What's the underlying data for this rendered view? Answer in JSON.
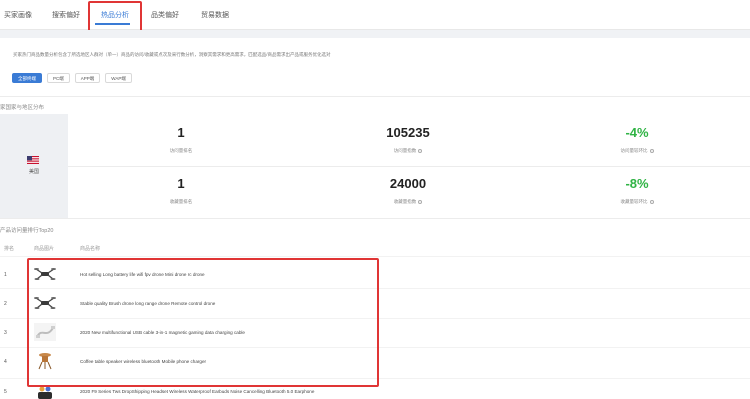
{
  "tabs": [
    {
      "label": "买家画像"
    },
    {
      "label": "搜索偏好"
    },
    {
      "label": "热品分析"
    },
    {
      "label": "品类偏好"
    },
    {
      "label": "贸易数据"
    }
  ],
  "description": "买家热门商品数量分析包含了所选地区人群对（单一）商品的访问/收藏或点次及采行数分析，洞察其需求和更高需求，匹配选品/商品需求出产品或服务优化选对",
  "filters": [
    {
      "label": "全部终端",
      "active": true
    },
    {
      "label": "PC端",
      "active": false
    },
    {
      "label": "APP端",
      "active": false
    },
    {
      "label": "WAP端",
      "active": false
    }
  ],
  "section_region": "家国家与地区分布",
  "region": {
    "name": "美国",
    "flag_icon": "us-flag-icon"
  },
  "metrics": {
    "rank_visit": {
      "value": "1",
      "label": "访问量排名"
    },
    "visit_index": {
      "value": "105235",
      "label": "访问量指数"
    },
    "visit_change": {
      "value": "-4%",
      "label": "访问量较环比"
    },
    "rank_fav": {
      "value": "1",
      "label": "收藏量排名"
    },
    "fav_index": {
      "value": "24000",
      "label": "收藏量指数"
    },
    "fav_change": {
      "value": "-8%",
      "label": "收藏量较环比"
    }
  },
  "section_top": "产品访问量排行Top20",
  "table": {
    "headers": {
      "rank": "排名",
      "image": "商品图片",
      "name": "商品名称"
    },
    "rows": [
      {
        "rank": "1",
        "image_icon": "drone-icon",
        "name": "Hot selling Long battery life wifi fpv drone Mini drone rc drone"
      },
      {
        "rank": "2",
        "image_icon": "drone-icon",
        "name": "Stable quality Brush drone long range drone Remote control drone"
      },
      {
        "rank": "3",
        "image_icon": "usb-cable-icon",
        "name": "2020 New multifunctional USB cable 3-in-1 magnetic gaming data charging cable"
      },
      {
        "rank": "4",
        "image_icon": "speaker-table-icon",
        "name": "Coffee table speaker wireless bluetooth Mobile phone charger"
      },
      {
        "rank": "5",
        "image_icon": "earbuds-icon",
        "name": "2020 F9 Series Tws DropShipping Headset Wireless Waterproof Earbuds Noise Cancelling Bluetooth 5.0 Earphone"
      }
    ]
  },
  "colors": {
    "accent": "#3a7bd5",
    "negative": "#2fb344",
    "highlight": "#e03535"
  }
}
